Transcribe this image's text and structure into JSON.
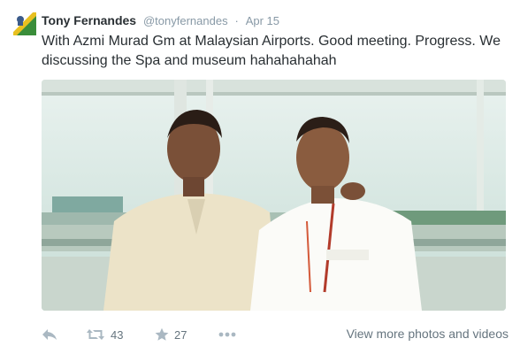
{
  "tweet": {
    "author_name": "Tony Fernandes",
    "author_handle": "@tonyfernandes",
    "separator": "·",
    "date": "Apr 15",
    "text": "With Azmi Murad Gm at Malaysian Airports. Good meeting. Progress. We discussing the Spa and museum hahahahahah"
  },
  "photo": {
    "kind": "photograph of two men at an airport window"
  },
  "actions": {
    "reply_icon": "reply-icon",
    "retweet_icon": "retweet-icon",
    "retweet_count": "43",
    "favorite_icon": "star-icon",
    "favorite_count": "27",
    "more_icon": "more-dots-icon",
    "view_more_label": "View more photos and videos"
  },
  "colors": {
    "text": "#292f33",
    "muted": "#8899a6",
    "icon": "#aab8c2"
  }
}
